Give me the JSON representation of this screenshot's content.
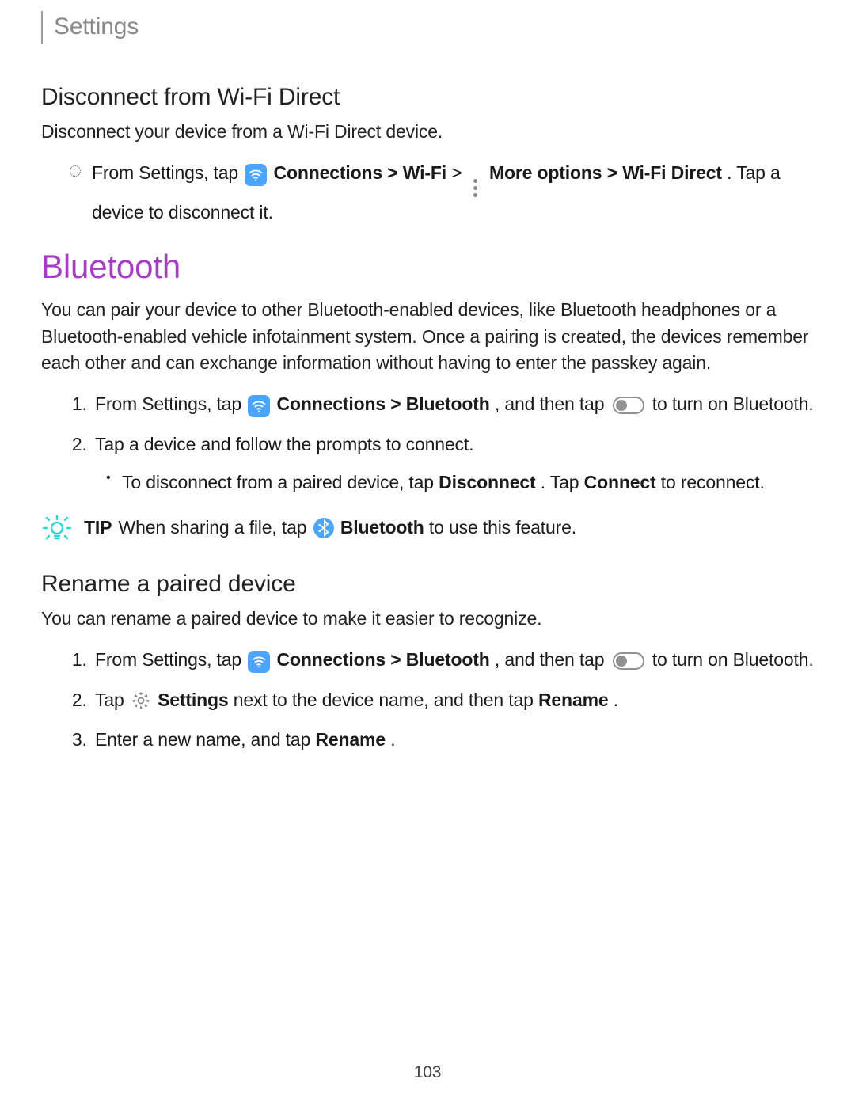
{
  "accent_color": "#a63cc3",
  "tip_icon_color": "#26d5d5",
  "breadcrumb": "Settings",
  "page_number": "103",
  "section1": {
    "heading": "Disconnect from Wi-Fi Direct",
    "intro": "Disconnect your device from a Wi-Fi Direct device.",
    "step_pre": "From Settings, tap ",
    "step_conn": "Connections",
    "step_gt": " > ",
    "step_wifi": "Wi-Fi",
    "step_more": "More options",
    "step_wfd": "Wi-Fi Direct",
    "step_tail": ". Tap a device to disconnect it."
  },
  "section2": {
    "heading": "Bluetooth",
    "intro": "You can pair your device to other Bluetooth-enabled devices, like Bluetooth headphones or a Bluetooth-enabled vehicle infotainment system. Once a pairing is created, the devices remember each other and can exchange information without having to enter the passkey again.",
    "step1_pre": "From Settings, tap ",
    "step1_conn": "Connections",
    "step1_bt": "Bluetooth",
    "step1_mid": ", and then tap ",
    "step1_tail": " to turn on Bluetooth.",
    "step2": "Tap a device and follow the prompts to connect.",
    "step2_sub_pre": "To disconnect from a paired device, tap ",
    "step2_sub_disc": "Disconnect",
    "step2_sub_mid": ". Tap ",
    "step2_sub_conn": "Connect",
    "step2_sub_tail": " to reconnect.",
    "tip_label": "TIP",
    "tip_pre": "  When sharing a file, tap ",
    "tip_bt": "Bluetooth",
    "tip_tail": " to use this feature."
  },
  "section3": {
    "heading": "Rename a paired device",
    "intro": "You can rename a paired device to make it easier to recognize.",
    "step1_pre": "From Settings, tap ",
    "step1_conn": "Connections",
    "step1_bt": "Bluetooth",
    "step1_mid": ", and then tap ",
    "step1_tail": " to turn on Bluetooth.",
    "step2_pre": "Tap ",
    "step2_settings": "Settings",
    "step2_mid": " next to the device name, and then tap ",
    "step2_rename": "Rename",
    "step2_tail": ".",
    "step3_pre": "Enter a new name, and tap ",
    "step3_rename": "Rename",
    "step3_tail": "."
  }
}
